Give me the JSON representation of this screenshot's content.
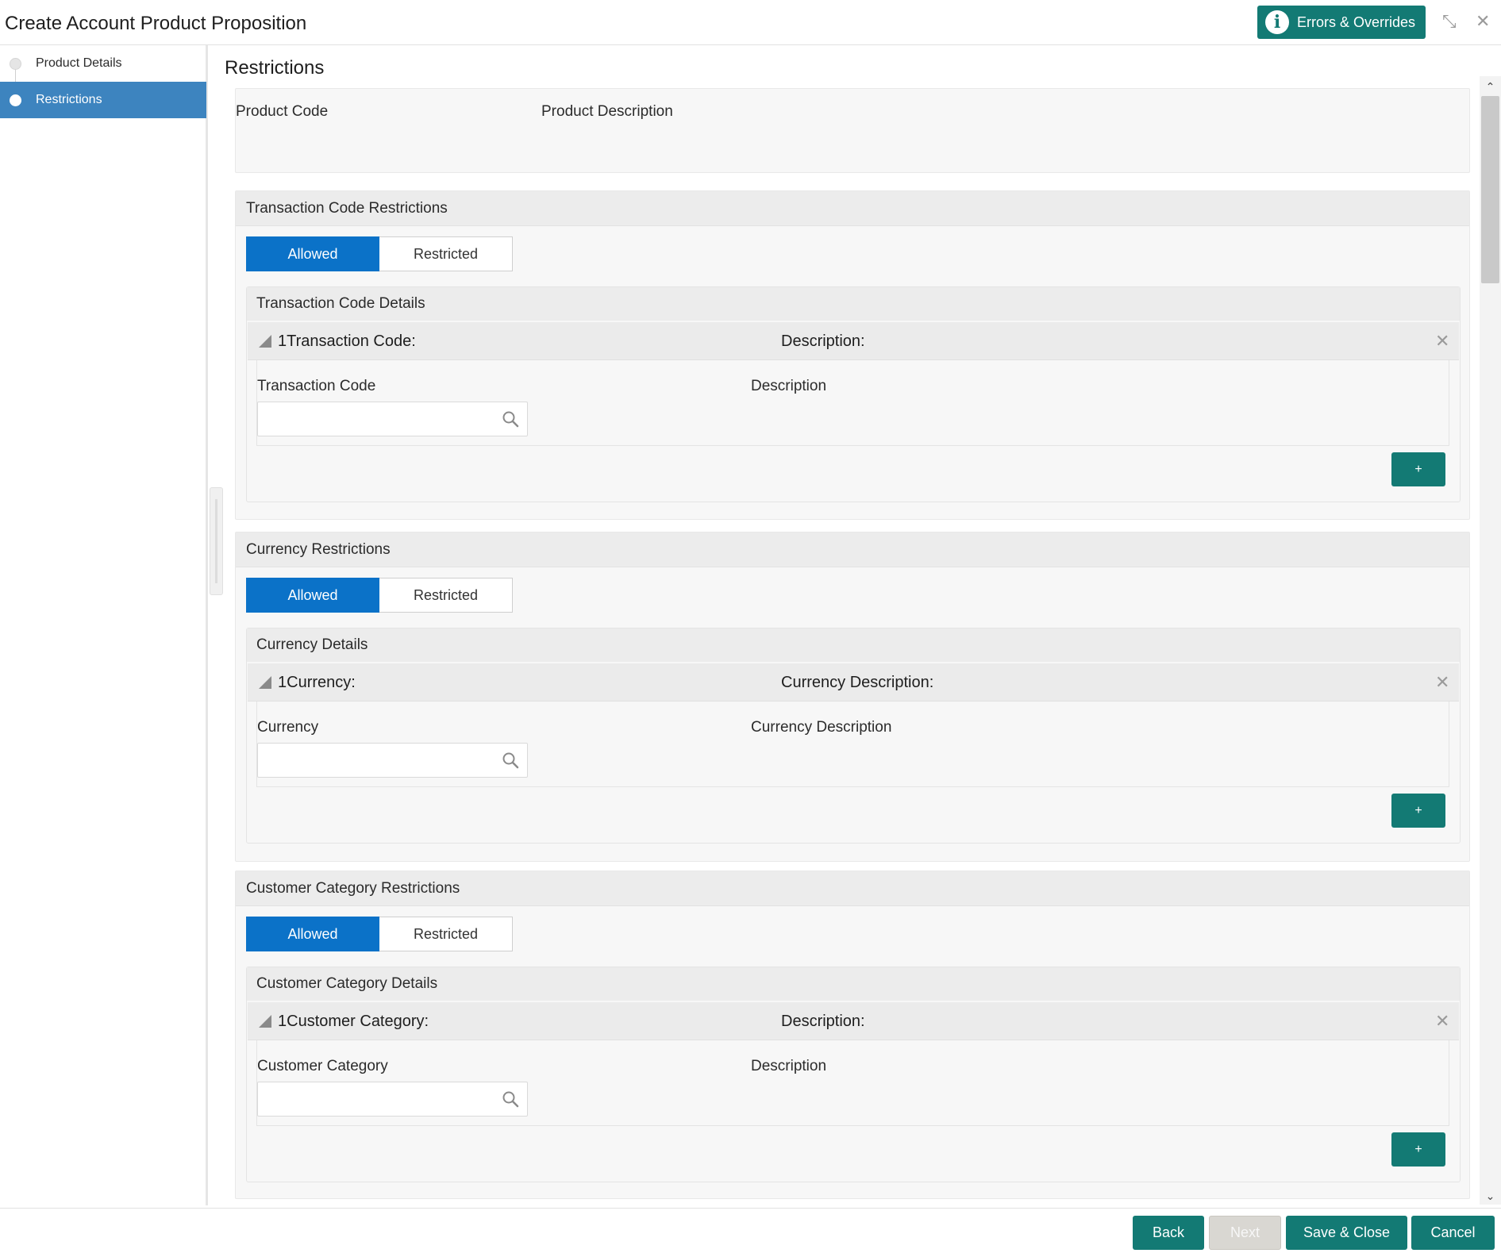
{
  "header": {
    "title": "Create Account Product Proposition",
    "errors_label": "Errors & Overrides",
    "info_glyph": "i",
    "minimize_glyph": "⤡",
    "close_glyph": "✕"
  },
  "sidebar": {
    "steps": [
      {
        "label": "Product Details",
        "active": false
      },
      {
        "label": "Restrictions",
        "active": true
      }
    ]
  },
  "main": {
    "title": "Restrictions",
    "product_code_label": "Product Code",
    "product_description_label": "Product Description",
    "sections": [
      {
        "title": "Transaction Code Restrictions",
        "allowed_label": "Allowed",
        "restricted_label": "Restricted",
        "details_title": "Transaction Code Details",
        "row_key": "1Transaction Code:",
        "row_desc": "Description:",
        "field1_label": "Transaction Code",
        "field2_label": "Description",
        "add_label": "+"
      },
      {
        "title": "Currency Restrictions",
        "allowed_label": "Allowed",
        "restricted_label": "Restricted",
        "details_title": "Currency Details",
        "row_key": "1Currency:",
        "row_desc": "Currency Description:",
        "field1_label": "Currency",
        "field2_label": "Currency Description",
        "add_label": "+"
      },
      {
        "title": "Customer Category Restrictions",
        "allowed_label": "Allowed",
        "restricted_label": "Restricted",
        "details_title": "Customer Category Details",
        "row_key": "1Customer Category:",
        "row_desc": "Description:",
        "field1_label": "Customer Category",
        "field2_label": "Description",
        "add_label": "+"
      }
    ],
    "row_close_glyph": "✕"
  },
  "scrollbar": {
    "up_glyph": "⌃",
    "down_glyph": "⌄"
  },
  "footer": {
    "back_label": "Back",
    "next_label": "Next",
    "save_close_label": "Save & Close",
    "cancel_label": "Cancel"
  },
  "colors": {
    "accent_teal": "#137a74",
    "toggle_blue": "#0b72c8",
    "sidebar_active": "#3d84bf"
  }
}
